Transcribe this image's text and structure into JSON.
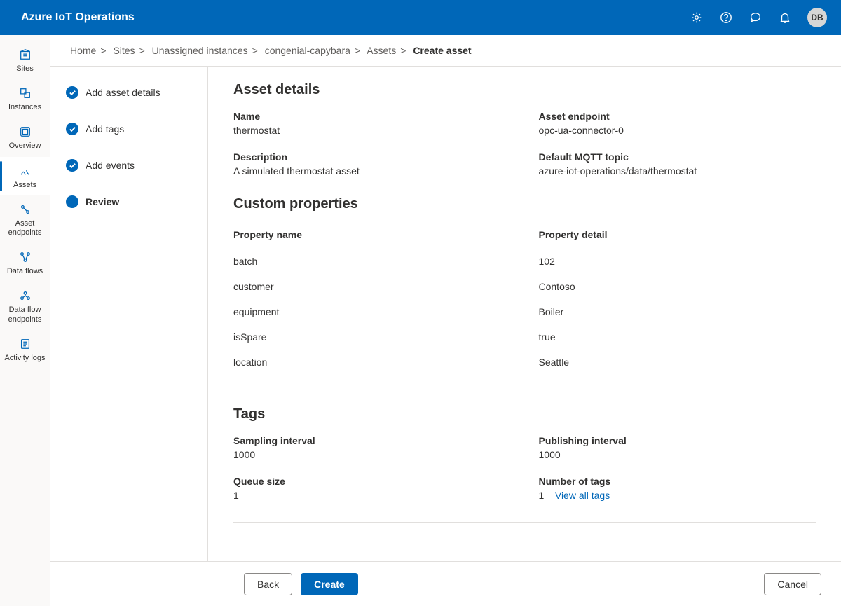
{
  "header": {
    "brand": "Azure IoT Operations",
    "avatar": "DB"
  },
  "nav": {
    "items": [
      {
        "label": "Sites"
      },
      {
        "label": "Instances"
      },
      {
        "label": "Overview"
      },
      {
        "label": "Assets"
      },
      {
        "label": "Asset endpoints"
      },
      {
        "label": "Data flows"
      },
      {
        "label": "Data flow endpoints"
      },
      {
        "label": "Activity logs"
      }
    ]
  },
  "breadcrumb": {
    "items": [
      "Home",
      "Sites",
      "Unassigned instances",
      "congenial-capybara",
      "Assets"
    ],
    "current": "Create asset"
  },
  "steps": [
    {
      "label": "Add asset details"
    },
    {
      "label": "Add tags"
    },
    {
      "label": "Add events"
    },
    {
      "label": "Review"
    }
  ],
  "sections": {
    "asset_details_title": "Asset details",
    "custom_props_title": "Custom properties",
    "tags_title": "Tags"
  },
  "asset": {
    "name_label": "Name",
    "name": "thermostat",
    "endpoint_label": "Asset endpoint",
    "endpoint": "opc-ua-connector-0",
    "desc_label": "Description",
    "desc": "A simulated thermostat asset",
    "mqtt_label": "Default MQTT topic",
    "mqtt": "azure-iot-operations/data/thermostat"
  },
  "props": {
    "name_header": "Property name",
    "detail_header": "Property detail",
    "rows": [
      {
        "name": "batch",
        "detail": "102"
      },
      {
        "name": "customer",
        "detail": "Contoso"
      },
      {
        "name": "equipment",
        "detail": "Boiler"
      },
      {
        "name": "isSpare",
        "detail": "true"
      },
      {
        "name": "location",
        "detail": "Seattle"
      }
    ]
  },
  "tags": {
    "sampling_label": "Sampling interval",
    "sampling": "1000",
    "publishing_label": "Publishing interval",
    "publishing": "1000",
    "queue_label": "Queue size",
    "queue": "1",
    "num_label": "Number of tags",
    "num": "1",
    "view_all": "View all tags"
  },
  "footer": {
    "back": "Back",
    "create": "Create",
    "cancel": "Cancel"
  }
}
